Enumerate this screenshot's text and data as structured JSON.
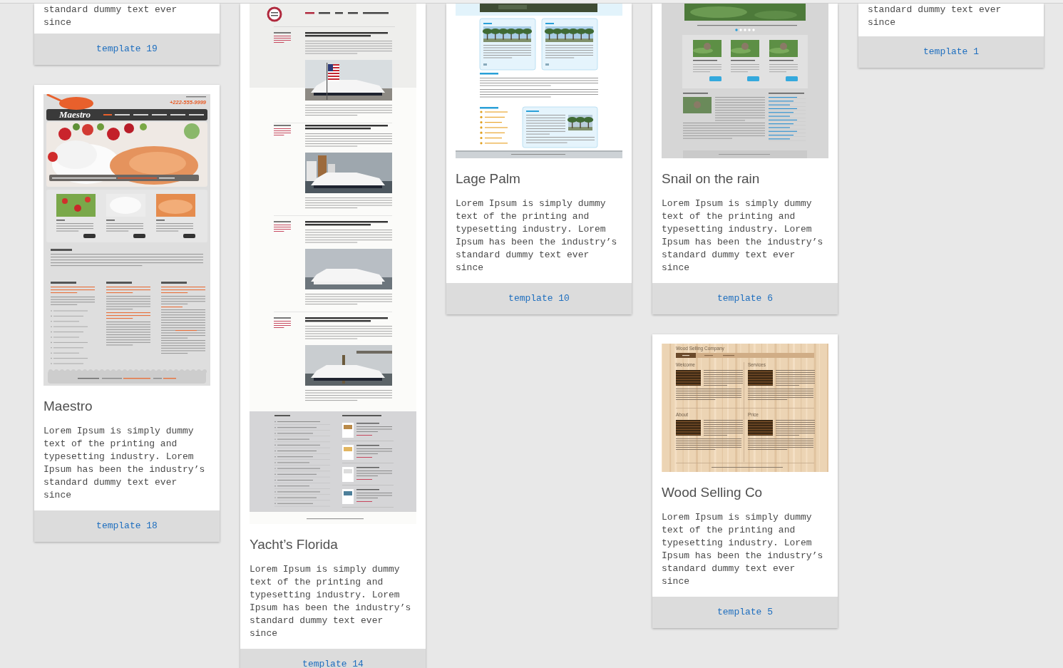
{
  "columns": [
    {
      "cards": [
        {
          "description": "standard dummy text ever since",
          "link": "template 19"
        },
        {
          "preview": {
            "kind": "restaurant",
            "texts": [
              "Maestro",
              "+222-555-9999"
            ]
          },
          "title": "Maestro",
          "description": "Lorem Ipsum is simply dummy text of the printing and typesetting industry. Lorem Ipsum has been the industry’s standard dummy text ever since",
          "link": "template 18"
        }
      ]
    },
    {
      "cards": [
        {
          "preview": {
            "kind": "blog"
          },
          "title": "Yacht’s Florida",
          "description": "Lorem Ipsum is simply dummy text of the printing and typesetting industry. Lorem Ipsum has been the industry’s standard dummy text ever since",
          "link": "template 14"
        }
      ]
    },
    {
      "cards": [
        {
          "preview": {
            "kind": "palm"
          },
          "title": "Lage Palm",
          "description": "Lorem Ipsum is simply dummy text of the printing and typesetting industry. Lorem Ipsum has been the industry’s standard dummy text ever since",
          "link": "template 10"
        }
      ]
    },
    {
      "cards": [
        {
          "preview": {
            "kind": "snail"
          },
          "title": "Snail on the rain",
          "description": "Lorem Ipsum is simply dummy text of the printing and typesetting industry. Lorem Ipsum has been the industry’s standard dummy text ever since",
          "link": "template 6"
        },
        {
          "preview": {
            "kind": "wood",
            "texts": [
              "Wood Selling Company",
              "Welcome",
              "Services",
              "About",
              "Price"
            ]
          },
          "title": "Wood Selling Co",
          "description": "Lorem Ipsum is simply dummy text of the printing and typesetting industry. Lorem Ipsum has been the industry’s standard dummy text ever since",
          "link": "template 5"
        }
      ]
    },
    {
      "cards": [
        {
          "description": "standard dummy text ever since",
          "link": "template 1"
        }
      ]
    }
  ]
}
